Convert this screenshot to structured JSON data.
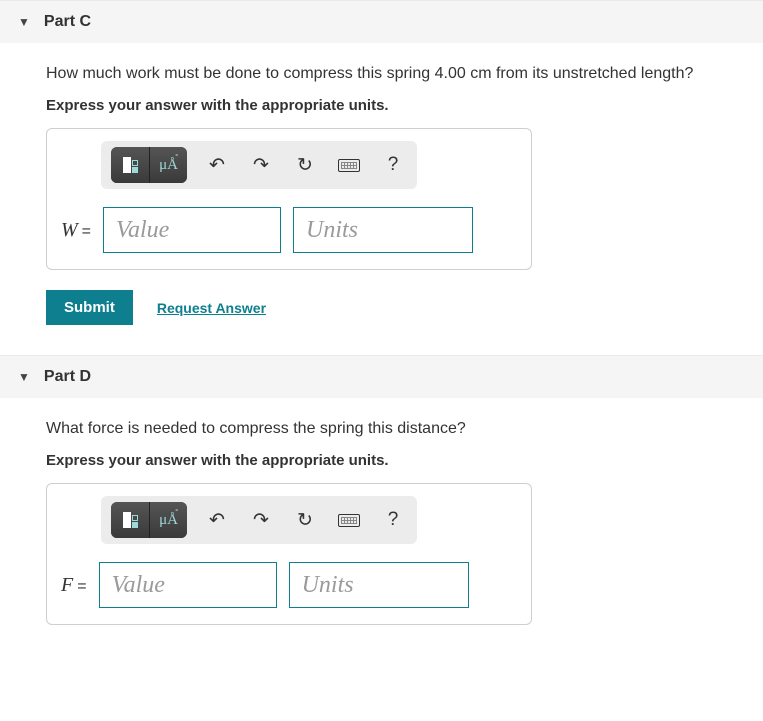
{
  "parts": {
    "c": {
      "title": "Part C",
      "question": "How much work must be done to compress this spring 4.00 cm from its unstretched length?",
      "instruction": "Express your answer with the appropriate units.",
      "variable": "W",
      "equals": "=",
      "value_placeholder": "Value",
      "units_placeholder": "Units",
      "submit_label": "Submit",
      "request_label": "Request Answer"
    },
    "d": {
      "title": "Part D",
      "question": "What force is needed to compress the spring this distance?",
      "instruction": "Express your answer with the appropriate units.",
      "variable": "F",
      "equals": "=",
      "value_placeholder": "Value",
      "units_placeholder": "Units"
    }
  },
  "toolbar": {
    "template_label": "template",
    "symbols_label": "μÅ",
    "undo": "↶",
    "redo": "↷",
    "reset": "↻",
    "keyboard": "keyboard",
    "help": "?"
  }
}
